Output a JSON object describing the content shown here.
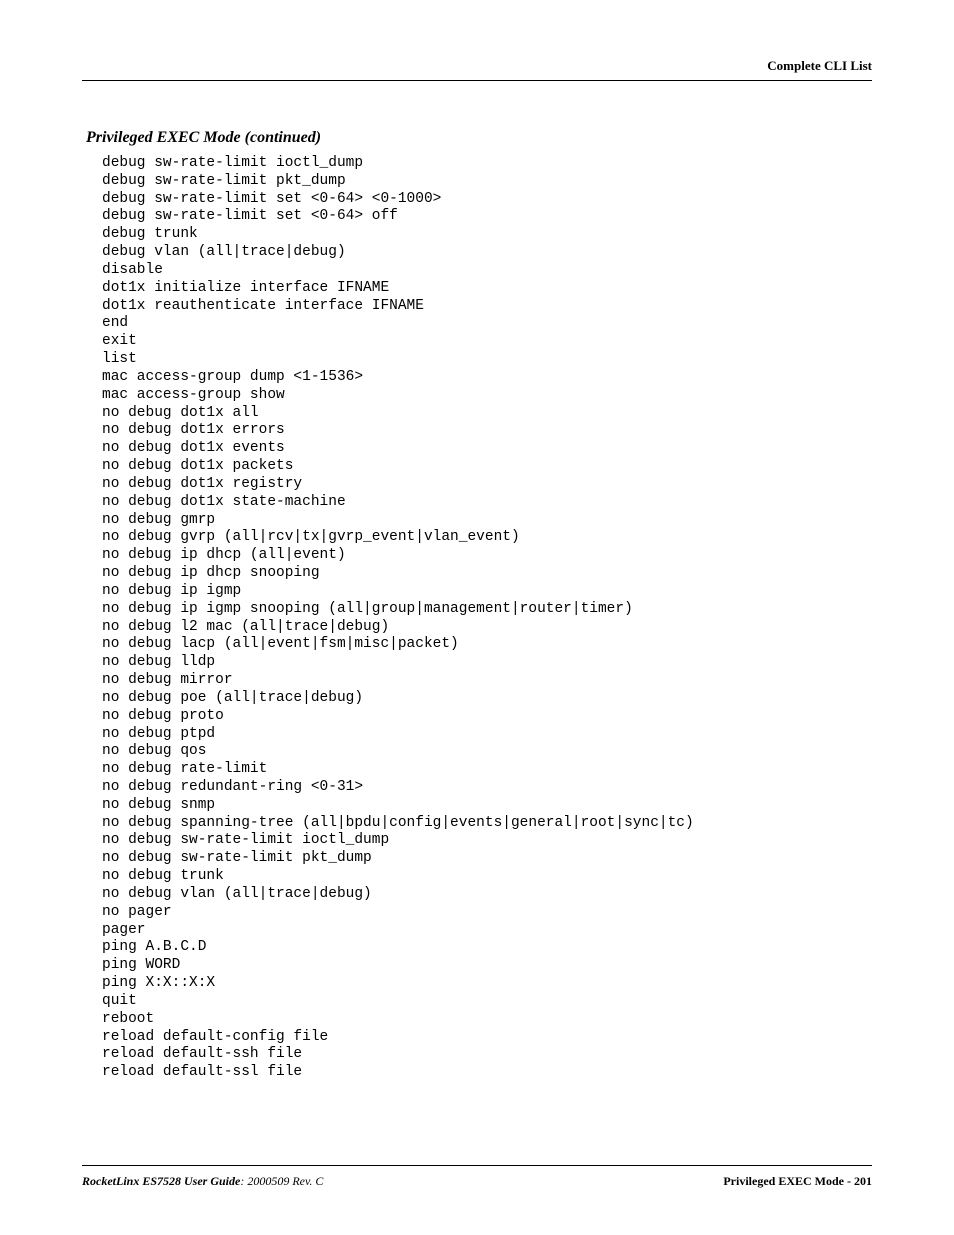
{
  "header": {
    "title": "Complete CLI List"
  },
  "section": {
    "title": "Privileged EXEC Mode (continued)"
  },
  "commands": [
    "debug sw-rate-limit ioctl_dump",
    "debug sw-rate-limit pkt_dump",
    "debug sw-rate-limit set <0-64> <0-1000>",
    "debug sw-rate-limit set <0-64> off",
    "debug trunk",
    "debug vlan (all|trace|debug)",
    "disable",
    "dot1x initialize interface IFNAME",
    "dot1x reauthenticate interface IFNAME",
    "end",
    "exit",
    "list",
    "mac access-group dump <1-1536>",
    "mac access-group show",
    "no debug dot1x all",
    "no debug dot1x errors",
    "no debug dot1x events",
    "no debug dot1x packets",
    "no debug dot1x registry",
    "no debug dot1x state-machine",
    "no debug gmrp",
    "no debug gvrp (all|rcv|tx|gvrp_event|vlan_event)",
    "no debug ip dhcp (all|event)",
    "no debug ip dhcp snooping",
    "no debug ip igmp",
    "no debug ip igmp snooping (all|group|management|router|timer)",
    "no debug l2 mac (all|trace|debug)",
    "no debug lacp (all|event|fsm|misc|packet)",
    "no debug lldp",
    "no debug mirror",
    "no debug poe (all|trace|debug)",
    "no debug proto",
    "no debug ptpd",
    "no debug qos",
    "no debug rate-limit",
    "no debug redundant-ring <0-31>",
    "no debug snmp",
    "no debug spanning-tree (all|bpdu|config|events|general|root|sync|tc)",
    "no debug sw-rate-limit ioctl_dump",
    "no debug sw-rate-limit pkt_dump",
    "no debug trunk",
    "no debug vlan (all|trace|debug)",
    "no pager",
    "pager",
    "ping A.B.C.D",
    "ping WORD",
    "ping X:X::X:X",
    "quit",
    "reboot",
    "reload default-config file",
    "reload default-ssh file",
    "reload default-ssl file"
  ],
  "footer": {
    "left_bold": "RocketLinx ES7528  User Guide",
    "left_normal": ": 2000509 Rev. C",
    "right": "Privileged EXEC Mode - 201"
  }
}
